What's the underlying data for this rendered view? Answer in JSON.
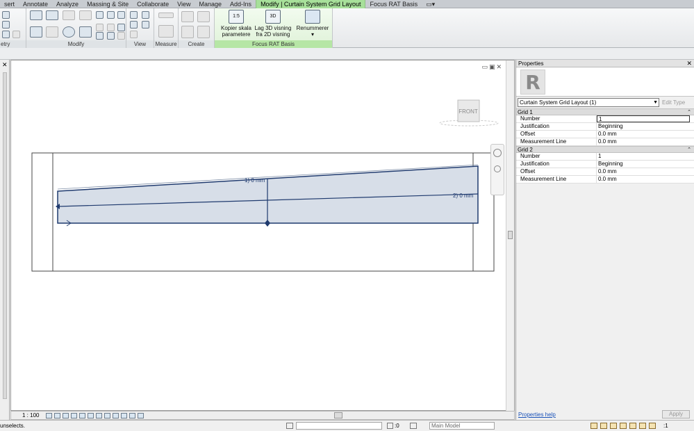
{
  "ribbon": {
    "tabs": [
      {
        "label": "sert"
      },
      {
        "label": "Annotate"
      },
      {
        "label": "Analyze"
      },
      {
        "label": "Massing & Site"
      },
      {
        "label": "Collaborate"
      },
      {
        "label": "View"
      },
      {
        "label": "Manage"
      },
      {
        "label": "Add-Ins"
      },
      {
        "label": "Modify | Curtain System Grid Layout"
      },
      {
        "label": "Focus RAT Basis"
      }
    ],
    "panels": {
      "partial_label": "etry",
      "modify": "Modify",
      "view": "View",
      "measure": "Measure",
      "create": "Create",
      "focus": "Focus RAT Basis"
    },
    "buttons": {
      "kopier_line1": "Kopier skala",
      "kopier_line2": "parametere",
      "kopier_icon": "1:5",
      "lag3d_line1": "Lag 3D visning",
      "lag3d_line2": "fra 2D visning",
      "lag3d_icon": "3D",
      "renummerer": "Renummerer"
    }
  },
  "view": {
    "viewcube_label": "FRONT",
    "grid_labels": [
      "1) 0 mm",
      "2) 0 mm"
    ],
    "scale": "1 : 100"
  },
  "properties": {
    "title": "Properties",
    "type_name": "Curtain System Grid Layout (1)",
    "edit_type": "Edit Type",
    "groups": [
      {
        "name": "Grid 1",
        "rows": [
          {
            "name": "Number",
            "value": "1"
          },
          {
            "name": "Justification",
            "value": "Beginning"
          },
          {
            "name": "Offset",
            "value": "0.0 mm"
          },
          {
            "name": "Measurement Line",
            "value": "0.0 mm"
          }
        ]
      },
      {
        "name": "Grid 2",
        "rows": [
          {
            "name": "Number",
            "value": "1"
          },
          {
            "name": "Justification",
            "value": "Beginning"
          },
          {
            "name": "Offset",
            "value": "0.0 mm"
          },
          {
            "name": "Measurement Line",
            "value": "0.0 mm"
          }
        ]
      }
    ],
    "help_link": "Properties help",
    "apply": "Apply"
  },
  "status": {
    "text": "unselects.",
    "selection_count": ":0",
    "model": "Main Model",
    "filter_count": ":1"
  },
  "colors": {
    "context_tab": "#a7e09a",
    "grid_fill": "#d7dee8",
    "grid_stroke": "#1f3a6e"
  }
}
